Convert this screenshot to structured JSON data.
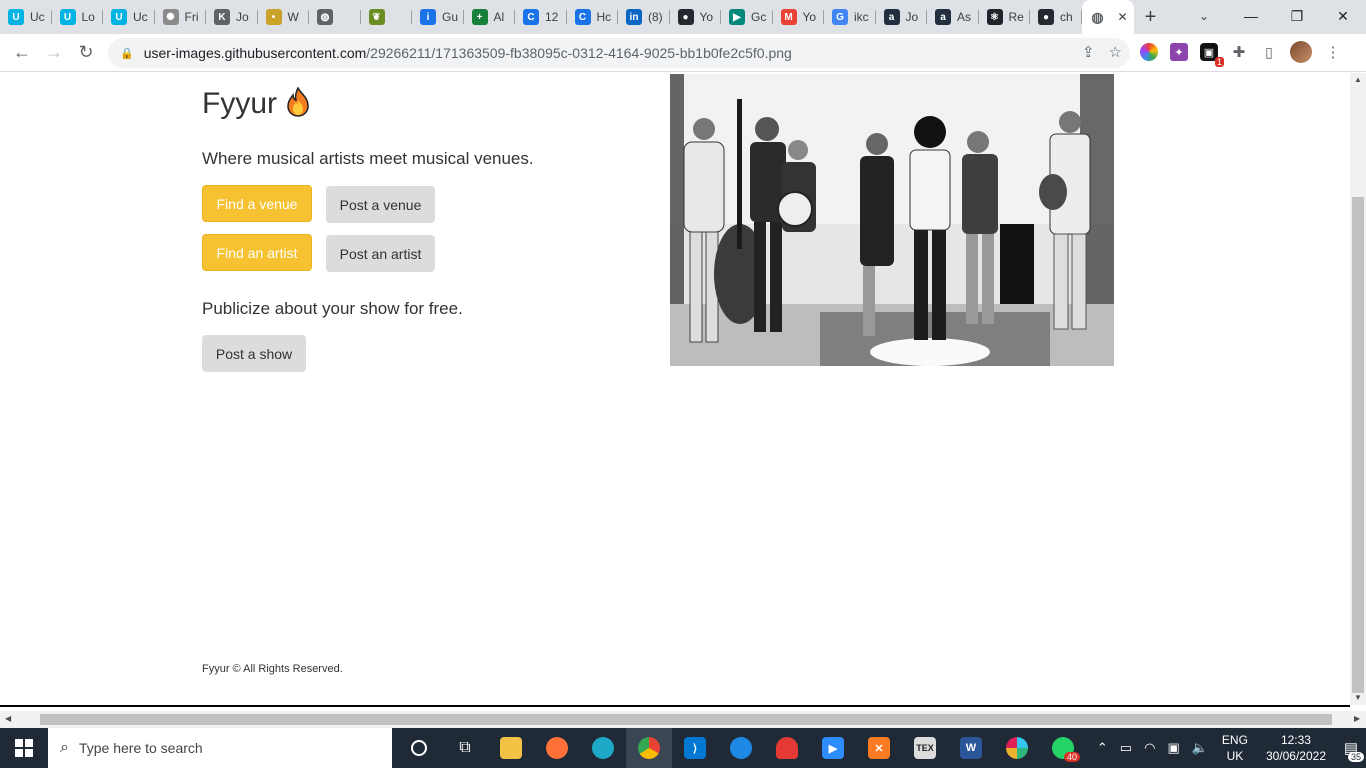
{
  "browser": {
    "tabs": [
      {
        "label": "Uc",
        "icon": "udacity-icon",
        "color": "#02b3e4",
        "glyph": "U"
      },
      {
        "label": "Lo",
        "icon": "udacity-icon",
        "color": "#02b3e4",
        "glyph": "U"
      },
      {
        "label": "Uc",
        "icon": "udacity-icon",
        "color": "#02b3e4",
        "glyph": "U"
      },
      {
        "label": "Fri",
        "icon": "dotted-globe-icon",
        "color": "#8a8a8a",
        "glyph": "✺"
      },
      {
        "label": "Jo",
        "icon": "k-logo-icon",
        "color": "#5f6368",
        "glyph": "K"
      },
      {
        "label": "W",
        "icon": "bulb-icon",
        "color": "#c9a227",
        "glyph": "•"
      },
      {
        "label": "",
        "icon": "globe-icon",
        "color": "#5f6368",
        "glyph": "◍"
      },
      {
        "label": "",
        "icon": "bird-icon",
        "color": "#6b8e23",
        "glyph": "❦"
      },
      {
        "label": "Gu",
        "icon": "info-icon",
        "color": "#1a73e8",
        "glyph": "i"
      },
      {
        "label": "Al",
        "icon": "plus-sheet-icon",
        "color": "#188038",
        "glyph": "+"
      },
      {
        "label": "12",
        "icon": "c-logo-icon",
        "color": "#1a73e8",
        "glyph": "C"
      },
      {
        "label": "Hc",
        "icon": "c-logo-icon",
        "color": "#1a73e8",
        "glyph": "C"
      },
      {
        "label": "(8)",
        "icon": "linkedin-icon",
        "color": "#0a66c2",
        "glyph": "in"
      },
      {
        "label": "Yo",
        "icon": "github-icon",
        "color": "#24292f",
        "glyph": "●"
      },
      {
        "label": "Gc",
        "icon": "meet-icon",
        "color": "#00897b",
        "glyph": "▶"
      },
      {
        "label": "Yo",
        "icon": "gmail-icon",
        "color": "#ea4335",
        "glyph": "M"
      },
      {
        "label": "ikc",
        "icon": "google-icon",
        "color": "#4285f4",
        "glyph": "G"
      },
      {
        "label": "Jo",
        "icon": "amazon-icon",
        "color": "#232f3e",
        "glyph": "a"
      },
      {
        "label": "As",
        "icon": "amazon-icon",
        "color": "#232f3e",
        "glyph": "a"
      },
      {
        "label": "Re",
        "icon": "react-icon",
        "color": "#20232a",
        "glyph": "⚛"
      },
      {
        "label": "ch",
        "icon": "github-icon",
        "color": "#24292f",
        "glyph": "●"
      }
    ],
    "active_tab_icon": "globe-icon",
    "url_host": "user-images.githubusercontent.com",
    "url_path": "/29266211/171363509-fb38095c-0312-4164-9025-bb1b0fe2c5f0.png"
  },
  "page": {
    "title": "Fyyur",
    "tagline": "Where musical artists meet musical venues.",
    "find_venue": "Find a venue",
    "post_venue": "Post a venue",
    "find_artist": "Find an artist",
    "post_artist": "Post an artist",
    "subline": "Publicize about your show for free.",
    "post_show": "Post a show",
    "footer": "Fyyur © All Rights Reserved.",
    "accent_color": "#f6c231"
  },
  "taskbar": {
    "search_placeholder": "Type here to search",
    "whatsapp_badge": "40",
    "lang_top": "ENG",
    "lang_bottom": "UK",
    "time": "12:33",
    "date": "30/06/2022",
    "notification_count": "35"
  }
}
